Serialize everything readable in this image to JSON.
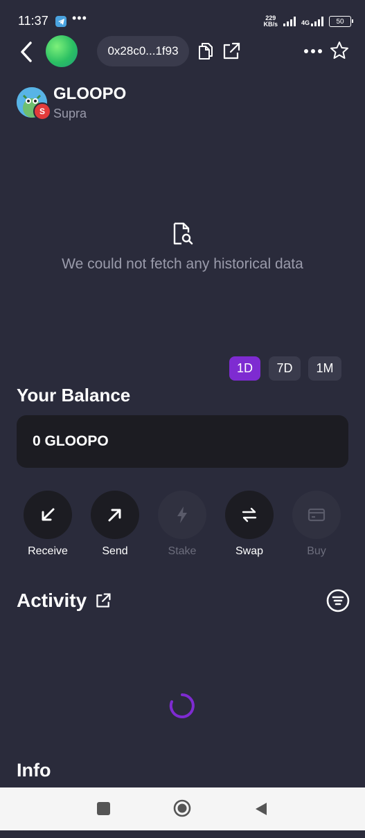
{
  "status_bar": {
    "time": "11:37",
    "overflow": "•••",
    "speed_value": "229",
    "speed_unit": "KB/s",
    "network": "4G",
    "battery": "50"
  },
  "header": {
    "address": "0x28c0...1f93"
  },
  "token": {
    "name": "GLOOPO",
    "chain": "Supra",
    "badge": "S"
  },
  "chart": {
    "empty_message": "We could not fetch any historical data",
    "periods": [
      {
        "label": "1D",
        "active": true
      },
      {
        "label": "7D",
        "active": false
      },
      {
        "label": "1M",
        "active": false
      }
    ]
  },
  "balance": {
    "title": "Your Balance",
    "value": "0 GLOOPO"
  },
  "actions": [
    {
      "label": "Receive",
      "icon": "arrow-down-left-icon",
      "enabled": true
    },
    {
      "label": "Send",
      "icon": "arrow-up-right-icon",
      "enabled": true
    },
    {
      "label": "Stake",
      "icon": "bolt-icon",
      "enabled": false
    },
    {
      "label": "Swap",
      "icon": "swap-arrows-icon",
      "enabled": true
    },
    {
      "label": "Buy",
      "icon": "card-icon",
      "enabled": false
    }
  ],
  "activity": {
    "title": "Activity"
  },
  "info": {
    "title": "Info"
  },
  "colors": {
    "background": "#2a2b3b",
    "accent": "#7e2bd1",
    "card": "#1c1c22",
    "muted_text": "#9a9bab"
  }
}
